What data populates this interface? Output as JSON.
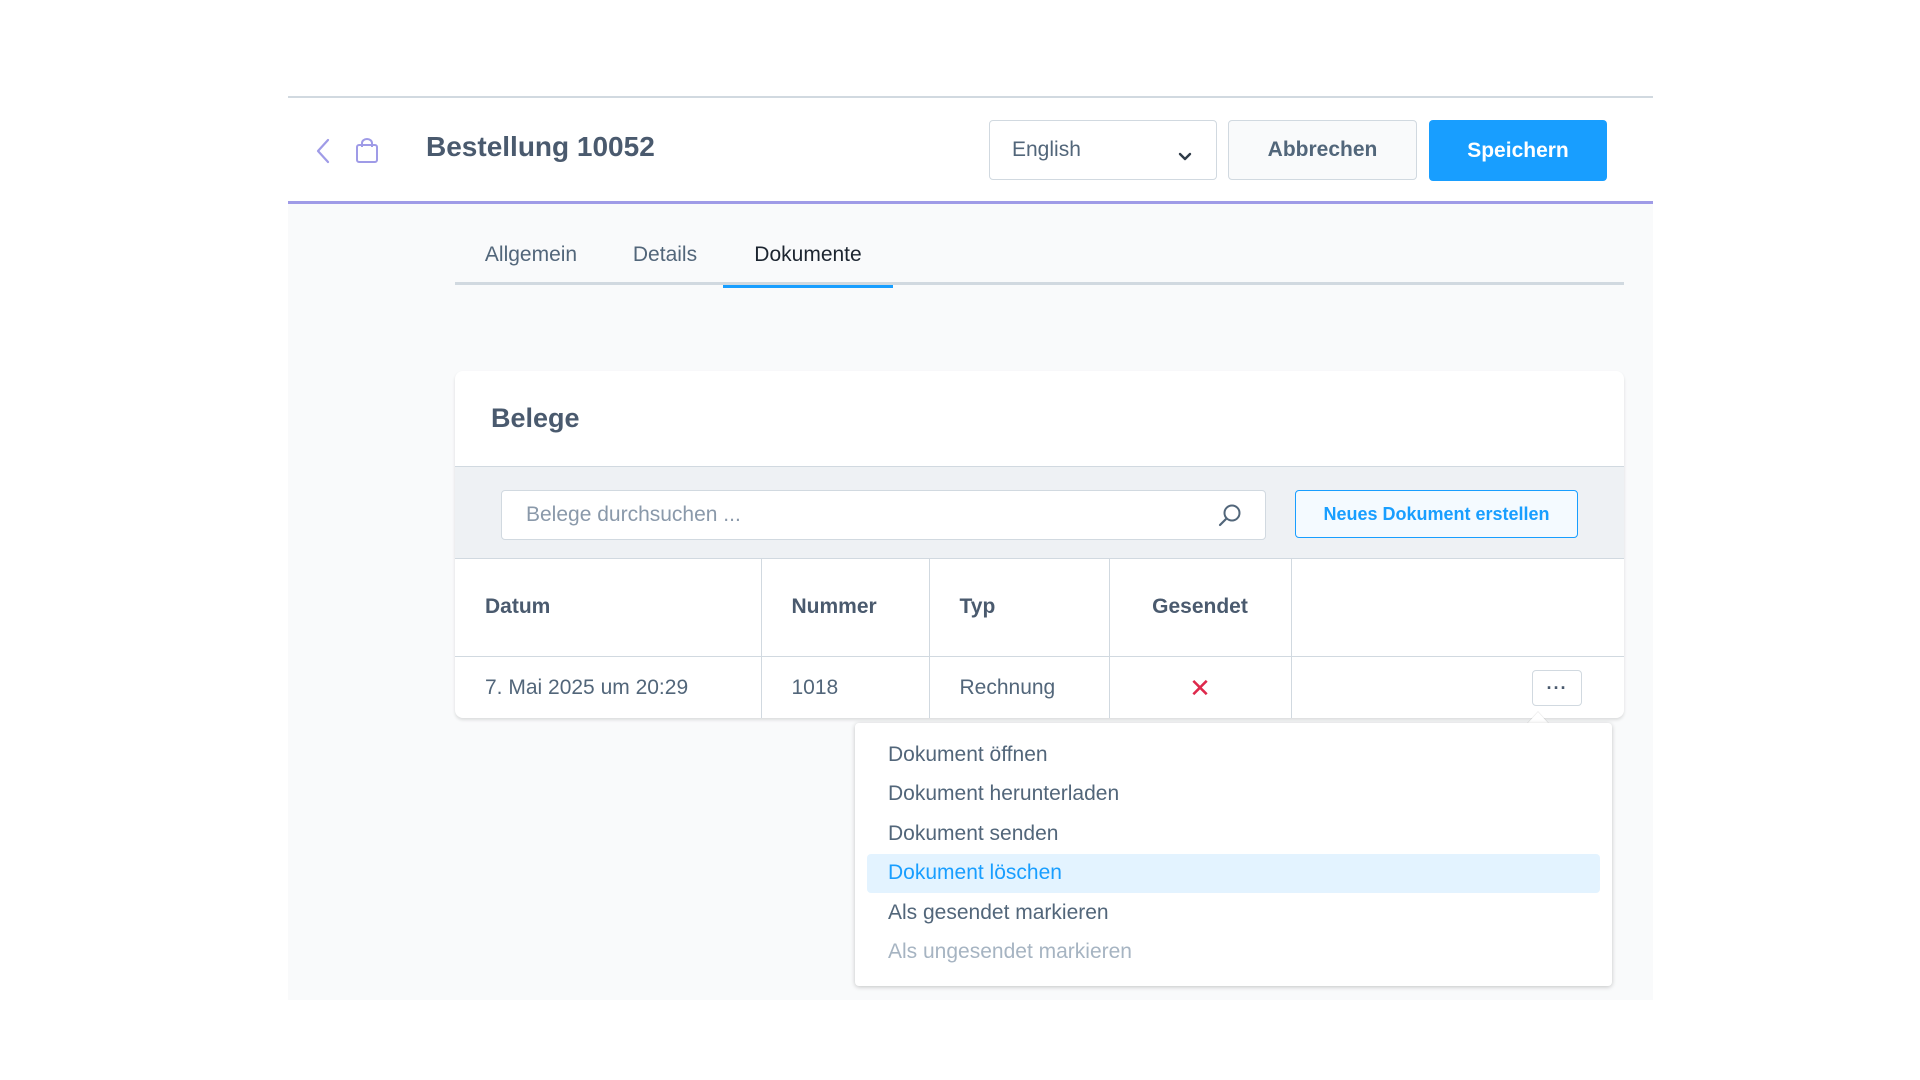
{
  "header": {
    "title": "Bestellung 10052",
    "language": "English",
    "cancel_label": "Abbrechen",
    "save_label": "Speichern"
  },
  "tabs": [
    {
      "label": "Allgemein",
      "active": false
    },
    {
      "label": "Details",
      "active": false
    },
    {
      "label": "Dokumente",
      "active": true
    }
  ],
  "card": {
    "title": "Belege",
    "search_placeholder": "Belege durchsuchen ...",
    "new_document_label": "Neues Dokument erstellen",
    "columns": [
      "Datum",
      "Nummer",
      "Typ",
      "Gesendet",
      ""
    ],
    "rows": [
      {
        "datum": "7. Mai 2025 um 20:29",
        "nummer": "1018",
        "typ": "Rechnung",
        "gesendet": "✕",
        "actions": "···"
      }
    ]
  },
  "context_menu": {
    "items": [
      {
        "label": "Dokument öffnen",
        "state": "normal"
      },
      {
        "label": "Dokument herunterladen",
        "state": "normal"
      },
      {
        "label": "Dokument senden",
        "state": "normal"
      },
      {
        "label": "Dokument löschen",
        "state": "active"
      },
      {
        "label": "Als gesendet markieren",
        "state": "normal"
      },
      {
        "label": "Als ungesendet markieren",
        "state": "disabled"
      }
    ]
  },
  "icons": {
    "back": "chevron-left-icon",
    "order": "shopping-bag-icon",
    "dropdown": "chevron-down-icon",
    "search": "search-icon",
    "not_sent": "x-icon",
    "more": "ellipsis-icon"
  },
  "colors": {
    "accent": "#189eff",
    "header_underline": "#9f9be7",
    "error": "#de294c",
    "menu_highlight": "#e3f3ff"
  }
}
